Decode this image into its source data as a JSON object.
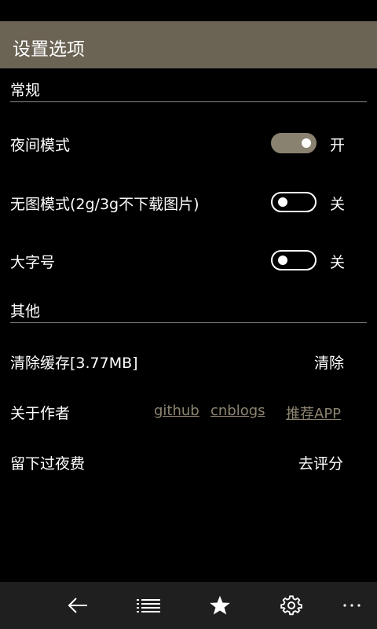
{
  "title": "设置选项",
  "sections": {
    "general": {
      "header": "常规",
      "night_mode": {
        "label": "夜间模式",
        "enabled": true,
        "state_text": "开"
      },
      "no_image": {
        "label": "无图模式(2g/3g不下载图片)",
        "enabled": false,
        "state_text": "关"
      },
      "large_font": {
        "label": "大字号",
        "enabled": false,
        "state_text": "关"
      }
    },
    "other": {
      "header": "其他",
      "clear_cache": {
        "label": "清除缓存[3.77MB]",
        "action": "清除"
      },
      "about": {
        "label": "关于作者",
        "links": [
          "github",
          "cnblogs",
          "推荐APP"
        ]
      },
      "feedback": {
        "label": "留下过夜费",
        "action": "去评分"
      }
    }
  },
  "appbar": {
    "icons": [
      "back-arrow-icon",
      "list-icon",
      "star-icon",
      "gear-icon",
      "more-icon"
    ]
  },
  "colors": {
    "accent": "#6b6354",
    "toggle_on": "#8a8270",
    "link": "#8c8470",
    "appbar_bg": "#1f1f1f"
  }
}
